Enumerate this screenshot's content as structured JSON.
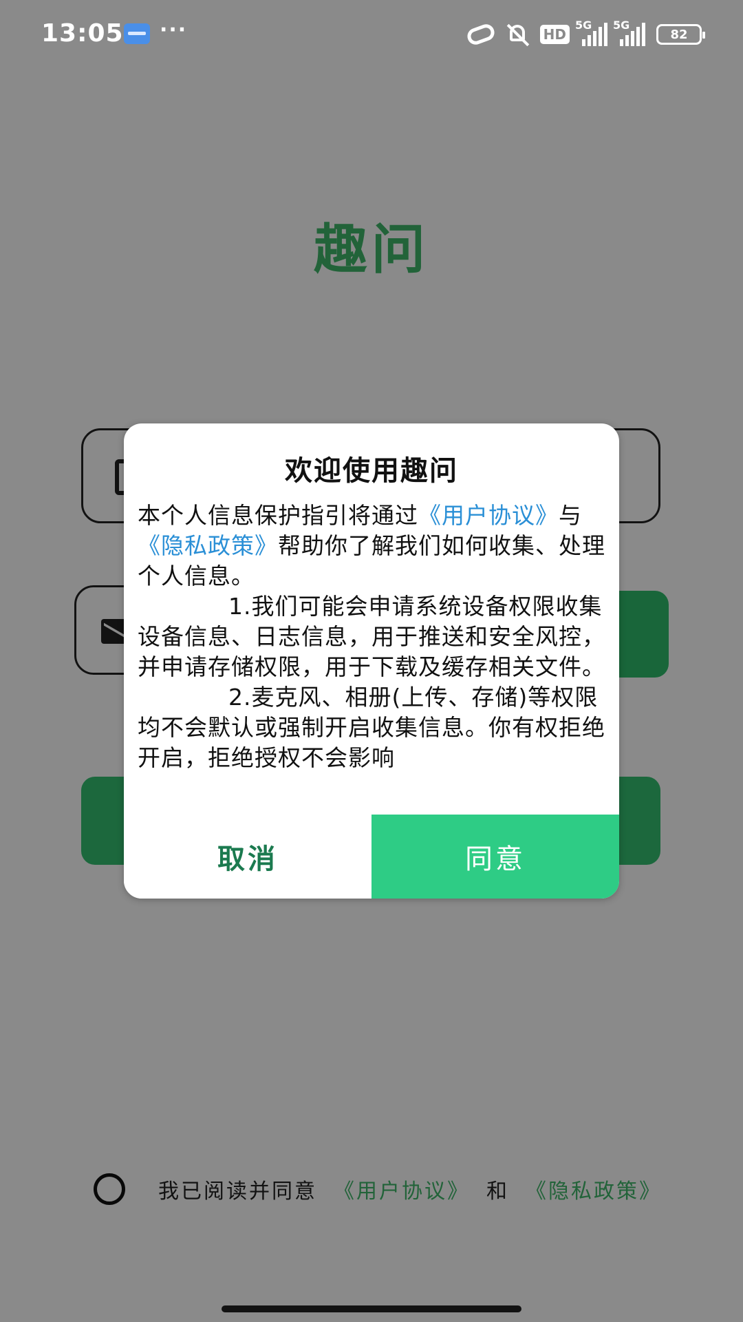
{
  "status_bar": {
    "time": "13:05",
    "dots": "···",
    "hd_label": "HD",
    "signal1_label": "5G",
    "signal2_label": "5G",
    "battery": "82"
  },
  "app": {
    "title": "趣问"
  },
  "agreement_row": {
    "text": "我已阅读并同意",
    "user_agreement": "《用户协议》",
    "and": "和",
    "privacy_policy": "《隐私政策》"
  },
  "dialog": {
    "title": "欢迎使用趣问",
    "intro_prefix": "本个人信息保护指引将通过",
    "link_user_agreement": "《用户协议》",
    "intro_mid": "与",
    "link_privacy_policy": "《隐私政策》",
    "intro_suffix": "帮助你了解我们如何收集、处理个人信息。",
    "paragraph1": "1.我们可能会申请系统设备权限收集设备信息、日志信息，用于推送和安全风控，并申请存储权限，用于下载及缓存相关文件。",
    "paragraph2": "2.麦克风、相册(上传、存储)等权限均不会默认或强制开启收集信息。你有权拒绝开启，拒绝授权不会影响",
    "cancel_label": "取消",
    "agree_label": "同意"
  }
}
